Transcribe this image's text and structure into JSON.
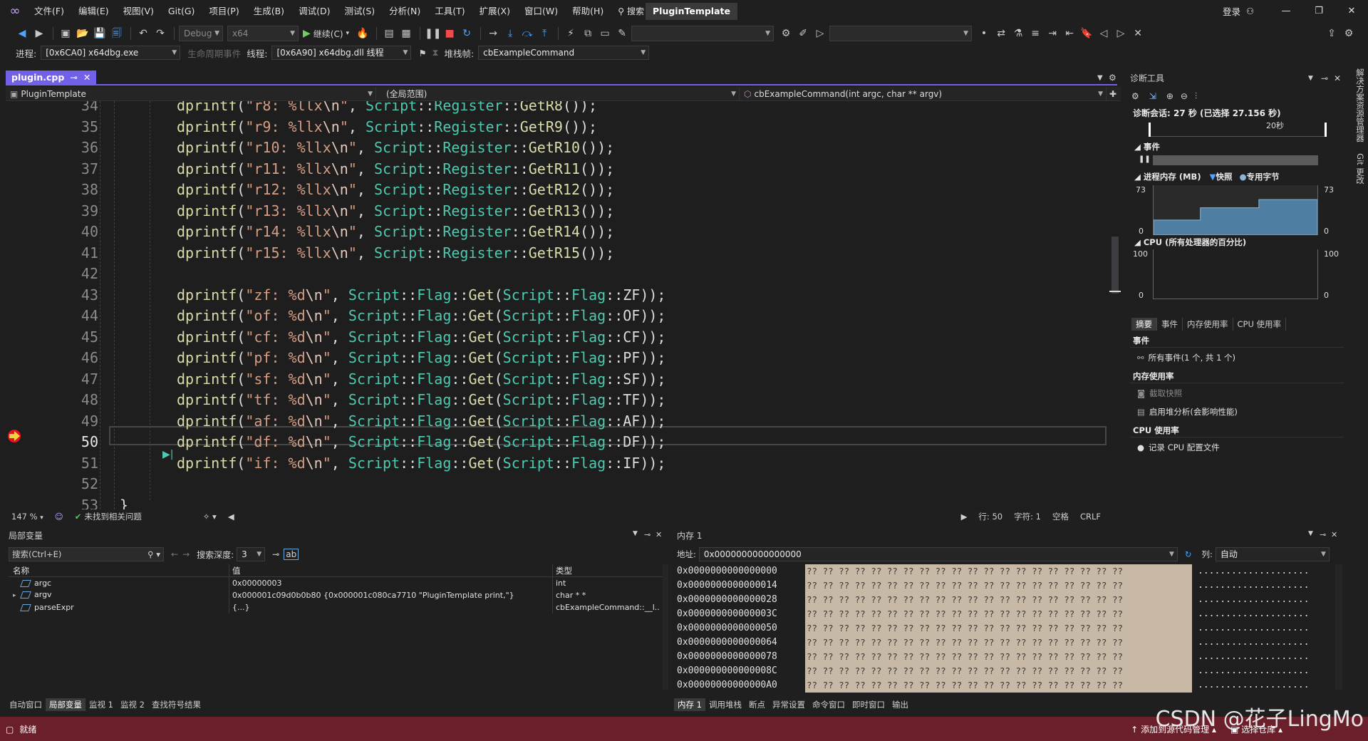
{
  "menubar": {
    "items": [
      "文件(F)",
      "编辑(E)",
      "视图(V)",
      "Git(G)",
      "项目(P)",
      "生成(B)",
      "调试(D)",
      "测试(S)",
      "分析(N)",
      "工具(T)",
      "扩展(X)",
      "窗口(W)",
      "帮助(H)"
    ],
    "search": "搜索",
    "solution": "PluginTemplate",
    "login": "登录"
  },
  "toolbar": {
    "config": "Debug",
    "platform": "x64",
    "continue": "继续(C)"
  },
  "debugbar": {
    "process_label": "进程:",
    "process": "[0x6CA0] x64dbg.exe",
    "lifecycle": "生命周期事件",
    "thread_label": "线程:",
    "thread": "[0x6A90] x64dbg.dll 线程",
    "stack_label": "堆栈帧:",
    "stack": "cbExampleCommand"
  },
  "editor": {
    "tab": "plugin.cpp",
    "project": "PluginTemplate",
    "scope": "(全局范围)",
    "function": "cbExampleCommand(int argc, char ** argv)",
    "current_line": 50,
    "lines": [
      {
        "n": "34",
        "fn": "dprintf",
        "s": "\"r8: %llx\\n\"",
        "reg": "GetR8"
      },
      {
        "n": "35",
        "fn": "dprintf",
        "s": "\"r9: %llx\\n\"",
        "reg": "GetR9"
      },
      {
        "n": "36",
        "fn": "dprintf",
        "s": "\"r10: %llx\\n\"",
        "reg": "GetR10"
      },
      {
        "n": "37",
        "fn": "dprintf",
        "s": "\"r11: %llx\\n\"",
        "reg": "GetR11"
      },
      {
        "n": "38",
        "fn": "dprintf",
        "s": "\"r12: %llx\\n\"",
        "reg": "GetR12"
      },
      {
        "n": "39",
        "fn": "dprintf",
        "s": "\"r13: %llx\\n\"",
        "reg": "GetR13"
      },
      {
        "n": "40",
        "fn": "dprintf",
        "s": "\"r14: %llx\\n\"",
        "reg": "GetR14"
      },
      {
        "n": "41",
        "fn": "dprintf",
        "s": "\"r15: %llx\\n\"",
        "reg": "GetR15"
      },
      {
        "n": "42"
      },
      {
        "n": "43",
        "flag": "ZF",
        "s": "\"zf: %d\\n\""
      },
      {
        "n": "44",
        "flag": "OF",
        "s": "\"of: %d\\n\""
      },
      {
        "n": "45",
        "flag": "CF",
        "s": "\"cf: %d\\n\""
      },
      {
        "n": "46",
        "flag": "PF",
        "s": "\"pf: %d\\n\""
      },
      {
        "n": "47",
        "flag": "SF",
        "s": "\"sf: %d\\n\""
      },
      {
        "n": "48",
        "flag": "TF",
        "s": "\"tf: %d\\n\""
      },
      {
        "n": "49",
        "flag": "AF",
        "s": "\"af: %d\\n\""
      },
      {
        "n": "50",
        "flag": "DF",
        "s": "\"df: %d\\n\""
      },
      {
        "n": "51",
        "flag": "IF",
        "s": "\"if: %d\\n\""
      },
      {
        "n": "52"
      },
      {
        "n": "53",
        "brace": "}"
      }
    ],
    "status": {
      "zoom": "147 %",
      "issues": "未找到相关问题",
      "line": "行: 50",
      "char": "字符: 1",
      "spaces": "空格",
      "eol": "CRLF"
    }
  },
  "diagnostics": {
    "title": "诊断工具",
    "session": "诊断会话: 27 秒 (已选择 27.156 秒)",
    "ruler_label": "20秒",
    "events": "事件",
    "process_memory": "进程内存 (MB)",
    "snapshot": "快照",
    "private_bytes": "专用字节",
    "mem_max": "73",
    "mem_min": "0",
    "cpu": "CPU (所有处理器的百分比)",
    "cpu_max": "100",
    "cpu_min": "0",
    "tabs": [
      "摘要",
      "事件",
      "内存使用率",
      "CPU 使用率"
    ],
    "section_events": "事件",
    "all_events": "所有事件(1 个, 共 1 个)",
    "section_memory": "内存使用率",
    "take_snapshot": "截取快照",
    "heap_profiling": "启用堆分析(会影响性能)",
    "section_cpu": "CPU 使用率",
    "record_cpu": "记录 CPU 配置文件",
    "rail": [
      "解决方案资源管理器",
      "Git 更改"
    ],
    "memory_series": [
      22,
      22,
      22,
      22,
      40,
      40,
      40,
      40,
      40,
      52,
      52,
      52,
      52,
      52,
      52
    ]
  },
  "locals": {
    "title": "局部变量",
    "search": "搜索(Ctrl+E)",
    "depth_label": "搜索深度:",
    "depth": "3",
    "headers": [
      "名称",
      "值",
      "类型"
    ],
    "rows": [
      {
        "name": "argc",
        "value": "0x00000003",
        "type": "int",
        "expand": ""
      },
      {
        "name": "argv",
        "value": "0x000001c09d0b0b80 {0x000001c080ca7710 \"PluginTemplate print,\"}",
        "type": "char * *",
        "expand": "▸"
      },
      {
        "name": "parseExpr",
        "value": "{...}",
        "type": "cbExampleCommand::__l...",
        "expand": ""
      }
    ],
    "tabs": [
      "自动窗口",
      "局部变量",
      "监视 1",
      "监视 2",
      "查找符号结果"
    ]
  },
  "memory": {
    "title": "内存 1",
    "addr_label": "地址:",
    "address": "0x0000000000000000",
    "cols_label": "列:",
    "cols": "自动",
    "rows": [
      {
        "addr": "0x0000000000000000",
        "bytes": "?? ?? ?? ?? ?? ?? ?? ?? ?? ?? ?? ?? ?? ?? ?? ?? ?? ?? ?? ??",
        "ascii": "...................."
      },
      {
        "addr": "0x0000000000000014",
        "bytes": "?? ?? ?? ?? ?? ?? ?? ?? ?? ?? ?? ?? ?? ?? ?? ?? ?? ?? ?? ??",
        "ascii": "...................."
      },
      {
        "addr": "0x0000000000000028",
        "bytes": "?? ?? ?? ?? ?? ?? ?? ?? ?? ?? ?? ?? ?? ?? ?? ?? ?? ?? ?? ??",
        "ascii": "...................."
      },
      {
        "addr": "0x000000000000003C",
        "bytes": "?? ?? ?? ?? ?? ?? ?? ?? ?? ?? ?? ?? ?? ?? ?? ?? ?? ?? ?? ??",
        "ascii": "...................."
      },
      {
        "addr": "0x0000000000000050",
        "bytes": "?? ?? ?? ?? ?? ?? ?? ?? ?? ?? ?? ?? ?? ?? ?? ?? ?? ?? ?? ??",
        "ascii": "...................."
      },
      {
        "addr": "0x0000000000000064",
        "bytes": "?? ?? ?? ?? ?? ?? ?? ?? ?? ?? ?? ?? ?? ?? ?? ?? ?? ?? ?? ??",
        "ascii": "...................."
      },
      {
        "addr": "0x0000000000000078",
        "bytes": "?? ?? ?? ?? ?? ?? ?? ?? ?? ?? ?? ?? ?? ?? ?? ?? ?? ?? ?? ??",
        "ascii": "...................."
      },
      {
        "addr": "0x000000000000008C",
        "bytes": "?? ?? ?? ?? ?? ?? ?? ?? ?? ?? ?? ?? ?? ?? ?? ?? ?? ?? ?? ??",
        "ascii": "...................."
      },
      {
        "addr": "0x00000000000000A0",
        "bytes": "?? ?? ?? ?? ?? ?? ?? ?? ?? ?? ?? ?? ?? ?? ?? ?? ?? ?? ?? ??",
        "ascii": "...................."
      }
    ],
    "tabs": [
      "内存 1",
      "调用堆栈",
      "断点",
      "异常设置",
      "命令窗口",
      "即时窗口",
      "输出"
    ]
  },
  "statusbar": {
    "ready": "就绪",
    "add_source": "添加到源代码管理",
    "select_repo": "选择仓库"
  },
  "watermark": "CSDN @花子LingMo",
  "colors": {
    "accent": "#7160e8",
    "statusbar": "#6b1f2a",
    "function": "#dcdcaa",
    "string": "#d69d85",
    "namespace": "#4ec9b0"
  }
}
